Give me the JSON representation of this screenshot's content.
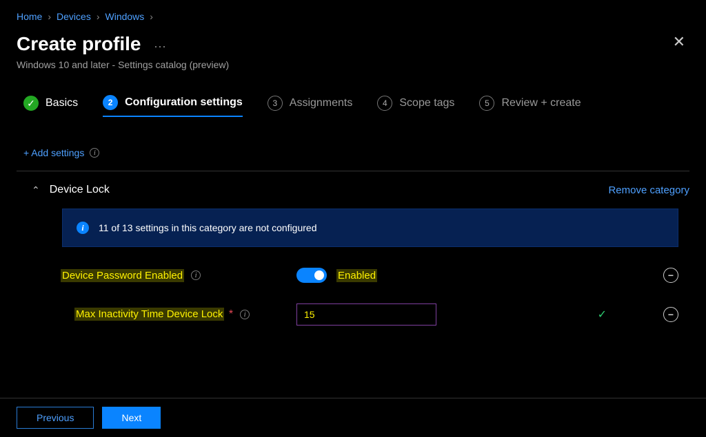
{
  "breadcrumb": {
    "items": [
      "Home",
      "Devices",
      "Windows"
    ]
  },
  "page_title": "Create profile",
  "page_subtitle": "Windows 10 and later - Settings catalog (preview)",
  "steps": [
    {
      "num": "✓",
      "label": "Basics",
      "state": "completed"
    },
    {
      "num": "2",
      "label": "Configuration settings",
      "state": "active"
    },
    {
      "num": "3",
      "label": "Assignments",
      "state": "future"
    },
    {
      "num": "4",
      "label": "Scope tags",
      "state": "future"
    },
    {
      "num": "5",
      "label": "Review + create",
      "state": "future"
    }
  ],
  "add_settings_label": "+ Add settings",
  "category": {
    "name": "Device Lock",
    "remove_label": "Remove category",
    "info_message": "11 of 13 settings in this category are not configured"
  },
  "settings": {
    "password_enabled": {
      "label": "Device Password Enabled",
      "toggle_state": "Enabled"
    },
    "max_inactivity": {
      "label": "Max Inactivity Time Device Lock",
      "required_marker": "*",
      "value": "15"
    }
  },
  "footer": {
    "previous": "Previous",
    "next": "Next"
  }
}
